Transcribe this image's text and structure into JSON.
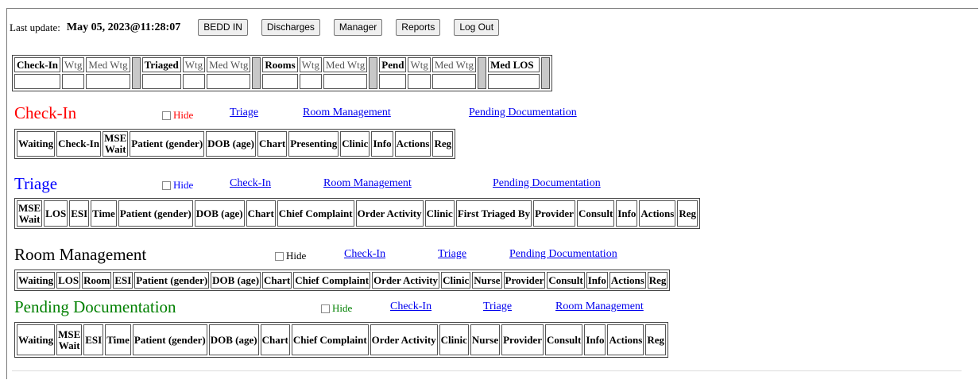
{
  "topbar": {
    "last_update_label": "Last update:",
    "last_update_value": "May 05, 2023@11:28:07",
    "buttons": [
      "BEDD IN",
      "Discharges",
      "Manager",
      "Reports",
      "Log Out"
    ]
  },
  "stats": {
    "groups": [
      {
        "head": "Check-In",
        "cols": [
          "Wtg",
          "Med Wtg"
        ]
      },
      {
        "head": "Triaged",
        "cols": [
          "Wtg",
          "Med Wtg"
        ]
      },
      {
        "head": "Rooms",
        "cols": [
          "Wtg",
          "Med Wtg"
        ]
      },
      {
        "head": "Pend",
        "cols": [
          "Wtg",
          "Med Wtg"
        ]
      }
    ],
    "med_los": "Med LOS"
  },
  "hide_label": "Hide",
  "sections": {
    "checkin": {
      "title": "Check-In",
      "color": "#ff0000",
      "links": [
        "Triage",
        "Room Management",
        "Pending Documentation"
      ],
      "columns": [
        "Waiting",
        "Check-In",
        "MSE Wait",
        "Patient (gender)",
        "DOB (age)",
        "Chart",
        "Presenting",
        "Clinic",
        "Info",
        "Actions",
        "Reg"
      ]
    },
    "triage": {
      "title": "Triage",
      "color": "#0000ff",
      "links": [
        "Check-In",
        "Room Management",
        "Pending Documentation"
      ],
      "columns": [
        "MSE Wait",
        "LOS",
        "ESI",
        "Time",
        "Patient (gender)",
        "DOB (age)",
        "Chart",
        "Chief Complaint",
        "Order Activity",
        "Clinic",
        "First Triaged By",
        "Provider",
        "Consult",
        "Info",
        "Actions",
        "Reg"
      ]
    },
    "rooms": {
      "title": "Room Management",
      "color": "#000000",
      "links": [
        "Check-In",
        "Triage",
        "Pending Documentation"
      ],
      "columns": [
        "Waiting",
        "LOS",
        "Room",
        "ESI",
        "Patient (gender)",
        "DOB (age)",
        "Chart",
        "Chief Complaint",
        "Order Activity",
        "Clinic",
        "Nurse",
        "Provider",
        "Consult",
        "Info",
        "Actions",
        "Reg"
      ]
    },
    "pending": {
      "title": "Pending Documentation",
      "color": "#008000",
      "links": [
        "Check-In",
        "Triage",
        "Room Management"
      ],
      "columns": [
        "Waiting",
        "MSE Wait",
        "ESI",
        "Time",
        "Patient (gender)",
        "DOB (age)",
        "Chart",
        "Chief Complaint",
        "Order Activity",
        "Clinic",
        "Nurse",
        "Provider",
        "Consult",
        "Info",
        "Actions",
        "Reg"
      ]
    }
  }
}
